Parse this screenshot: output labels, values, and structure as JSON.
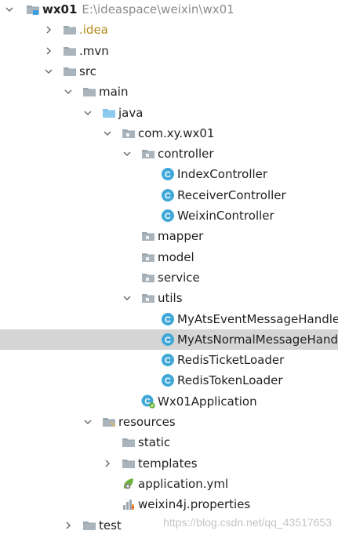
{
  "project": {
    "name": "wx01",
    "path": "E:\\ideaspace\\weixin\\wx01"
  },
  "nodes": [
    {
      "depth": 0,
      "arrow": "down",
      "icon": "module",
      "label": "wx01",
      "path_key": true
    },
    {
      "depth": 1,
      "arrow": "right",
      "icon": "folder",
      "label": ".idea",
      "style": "idea"
    },
    {
      "depth": 1,
      "arrow": "right",
      "icon": "folder",
      "label": ".mvn"
    },
    {
      "depth": 1,
      "arrow": "down",
      "icon": "folder",
      "label": "src"
    },
    {
      "depth": 2,
      "arrow": "down",
      "icon": "folder",
      "label": "main"
    },
    {
      "depth": 3,
      "arrow": "down",
      "icon": "folder-source",
      "label": "java"
    },
    {
      "depth": 4,
      "arrow": "down",
      "icon": "package",
      "label": "com.xy.wx01"
    },
    {
      "depth": 5,
      "arrow": "down",
      "icon": "package",
      "label": "controller"
    },
    {
      "depth": 6,
      "arrow": "none",
      "icon": "class",
      "label": "IndexController"
    },
    {
      "depth": 6,
      "arrow": "none",
      "icon": "class",
      "label": "ReceiverController"
    },
    {
      "depth": 6,
      "arrow": "none",
      "icon": "class",
      "label": "WeixinController"
    },
    {
      "depth": 5,
      "arrow": "none",
      "icon": "package",
      "label": "mapper"
    },
    {
      "depth": 5,
      "arrow": "none",
      "icon": "package",
      "label": "model"
    },
    {
      "depth": 5,
      "arrow": "none",
      "icon": "package",
      "label": "service"
    },
    {
      "depth": 5,
      "arrow": "down",
      "icon": "package",
      "label": "utils"
    },
    {
      "depth": 6,
      "arrow": "none",
      "icon": "class",
      "label": "MyAtsEventMessageHandler"
    },
    {
      "depth": 6,
      "arrow": "none",
      "icon": "class",
      "label": "MyAtsNormalMessageHandler",
      "selected": true
    },
    {
      "depth": 6,
      "arrow": "none",
      "icon": "class",
      "label": "RedisTicketLoader"
    },
    {
      "depth": 6,
      "arrow": "none",
      "icon": "class",
      "label": "RedisTokenLoader"
    },
    {
      "depth": 5,
      "arrow": "none",
      "icon": "spring-class",
      "label": "Wx01Application"
    },
    {
      "depth": 3,
      "arrow": "down",
      "icon": "folder-resources",
      "label": "resources"
    },
    {
      "depth": 4,
      "arrow": "none",
      "icon": "folder",
      "label": "static"
    },
    {
      "depth": 4,
      "arrow": "right",
      "icon": "folder",
      "label": "templates"
    },
    {
      "depth": 4,
      "arrow": "none",
      "icon": "spring-config",
      "label": "application.yml"
    },
    {
      "depth": 4,
      "arrow": "none",
      "icon": "properties",
      "label": "weixin4j.properties"
    },
    {
      "depth": 2,
      "arrow": "right",
      "icon": "folder",
      "label": "test"
    }
  ],
  "watermark": "https://blog.csdn.net/qq_43517653",
  "colors": {
    "folder": "#9aa7b0",
    "source_folder": "#7ec0e8",
    "class_circle": "#40a8d8",
    "selection": "#d5d5d5",
    "module_square": "#3aa0e0"
  }
}
